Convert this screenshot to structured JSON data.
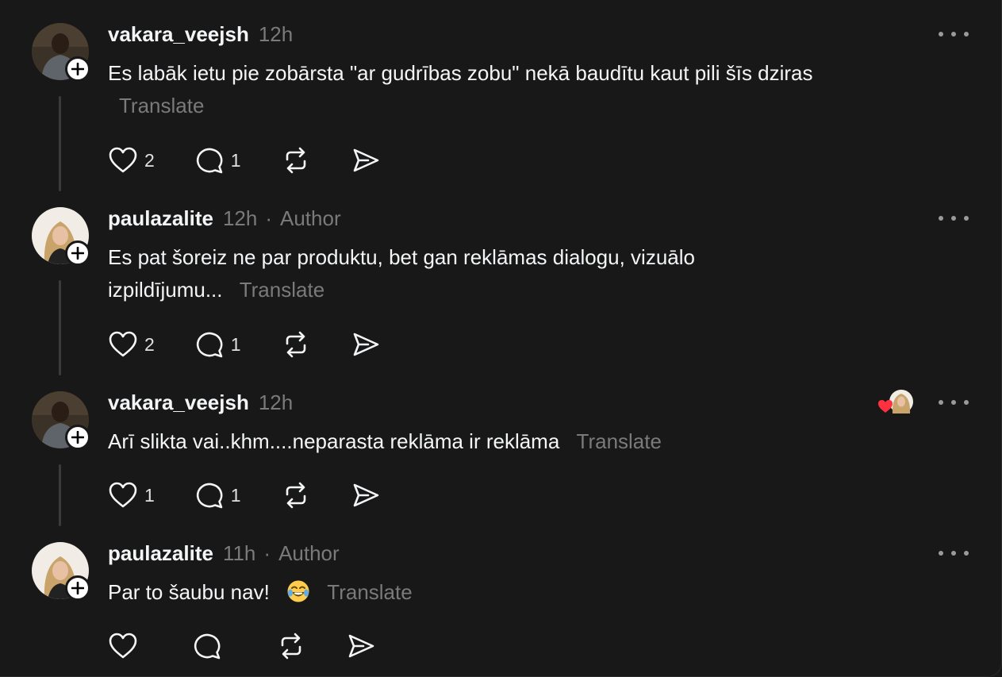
{
  "posts": [
    {
      "username": "vakara_veejsh",
      "time": "12h",
      "author_tag": "",
      "text": "Es labāk ietu pie zobārsta \"ar gudrības zobu\" nekā baudītu kaut pili šīs dziras",
      "translate": "Translate",
      "likes": "2",
      "replies": "1"
    },
    {
      "username": "paulazalite",
      "time": "12h",
      "separator": "·",
      "author_tag": "Author",
      "text": "Es pat šoreiz ne par produktu, bet gan reklāmas dialogu, vizuālo izpildījumu...",
      "translate": "Translate",
      "likes": "2",
      "replies": "1"
    },
    {
      "username": "vakara_veejsh",
      "time": "12h",
      "author_tag": "",
      "text": "Arī slikta vai..khm....neparasta reklāma ir reklāma",
      "translate": "Translate",
      "likes": "1",
      "replies": "1"
    },
    {
      "username": "paulazalite",
      "time": "11h",
      "separator": "·",
      "author_tag": "Author",
      "text": "Par to šaubu nav!",
      "translate": "Translate",
      "likes": "",
      "replies": ""
    }
  ],
  "icons": {
    "like": "heart-icon",
    "reply": "comment-icon",
    "repost": "repost-icon",
    "share": "send-icon",
    "more": "more-icon",
    "follow": "plus-icon",
    "emoji": "laughing-emoji-icon"
  },
  "colors": {
    "background": "#181818",
    "text": "#f3f5f7",
    "muted": "#7a7a7a",
    "heart_red": "#ff3040"
  }
}
